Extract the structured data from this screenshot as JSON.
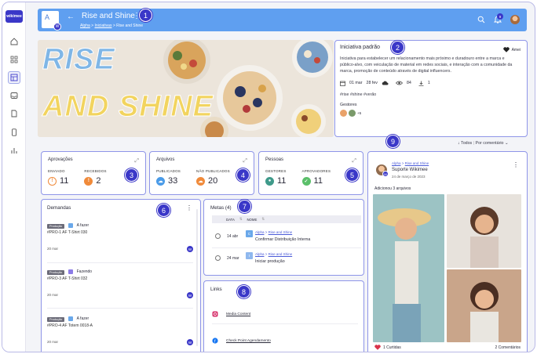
{
  "app": {
    "logo_text": "wikimee",
    "brand_color": "#3a37c8",
    "header_color": "#5f9ff0"
  },
  "nav": {
    "items": [
      "home-icon",
      "grid-icon",
      "layout-icon",
      "inbox-icon",
      "document-icon",
      "phone-icon",
      "chart-icon"
    ]
  },
  "header": {
    "tile_letter": "A",
    "tile_badge": "W",
    "title": "Rise and Shine",
    "breadcrumb": [
      "Alpha",
      "Iniciativas",
      "Rise and Shine"
    ],
    "notifications_count": "9"
  },
  "markers": [
    "1",
    "2",
    "3",
    "4",
    "5",
    "6",
    "7",
    "8",
    "9"
  ],
  "hero": {
    "line1": "RISE",
    "line2": "AND SHINE"
  },
  "info": {
    "title": "Iniciativa padrão",
    "like_label": "Amei",
    "description": "Iniciativa para estabelecer um relacionamento mais próximo e duradouro entre a marca e público-alvo, com veiculação de material em redes sociais, e interação com a comunidade da marca, promoção de conteúdo através de digital influencers.",
    "start": "01 mar",
    "end": "28 fev",
    "views": "84",
    "downloads": "1",
    "tags": "#rise  #shine  #verão",
    "managers_label": "Gestores",
    "managers_more": "+5"
  },
  "sort": {
    "label": "Todos",
    "mode": "Por comentário"
  },
  "approvals": {
    "title": "Aprovações",
    "sent_label": "ENVIADO",
    "sent_value": "11",
    "received_label": "RECEBIDOS",
    "received_value": "2"
  },
  "files": {
    "title": "Arquivos",
    "published_label": "PUBLICADOS",
    "published_value": "33",
    "unpublished_label": "NÃO PUBLICADOS",
    "unpublished_value": "20"
  },
  "people": {
    "title": "Pessoas",
    "managers_label": "GESTORES",
    "managers_value": "11",
    "approvers_label": "APROVADORES",
    "approvers_value": "11"
  },
  "demands": {
    "title": "Demandas",
    "items": [
      {
        "chip": "Produção",
        "status": "A fazer",
        "color": "#6aa8ea",
        "code": "#PRO-1 AF T-Shirt 030",
        "date": "20 mar"
      },
      {
        "chip": "Produção",
        "status": "Fazendo",
        "color": "#8b7be6",
        "code": "#PRO-3 AF T-Shirt 032",
        "date": "20 mar"
      },
      {
        "chip": "Produção",
        "status": "A fazer",
        "color": "#6aa8ea",
        "code": "#PRO-4 AF Totem 0018-A",
        "date": "20 mar"
      }
    ],
    "assignee": "W"
  },
  "goals": {
    "title": "Metas",
    "count": "(4)",
    "col_date": "DATA",
    "col_name": "NOME",
    "rows": [
      {
        "date": "14 abr",
        "tile": "C",
        "crumb1": "Alpha",
        "crumb2": "Rise and Shine",
        "name": "Confirmar Distribuição Interna"
      },
      {
        "date": "24 mar",
        "tile": "I",
        "crumb1": "Alpha",
        "crumb2": "Rise and Shine",
        "name": "Iniciar produção"
      }
    ]
  },
  "links": {
    "title": "Links",
    "items": [
      {
        "icon": "instagram-icon",
        "label": "Media Content"
      },
      {
        "icon": "facebook-icon",
        "label": "Check Point Agendamento"
      }
    ]
  },
  "feed": {
    "crumb1": "Alpha",
    "crumb2": "Rise and Shine",
    "author": "Suporte Wikimee",
    "date": "24 de março de 2023",
    "text": "Adicionou 3 arquivos",
    "likes": "1 Curtidas",
    "comments": "2 Comentários",
    "badge": "W"
  }
}
